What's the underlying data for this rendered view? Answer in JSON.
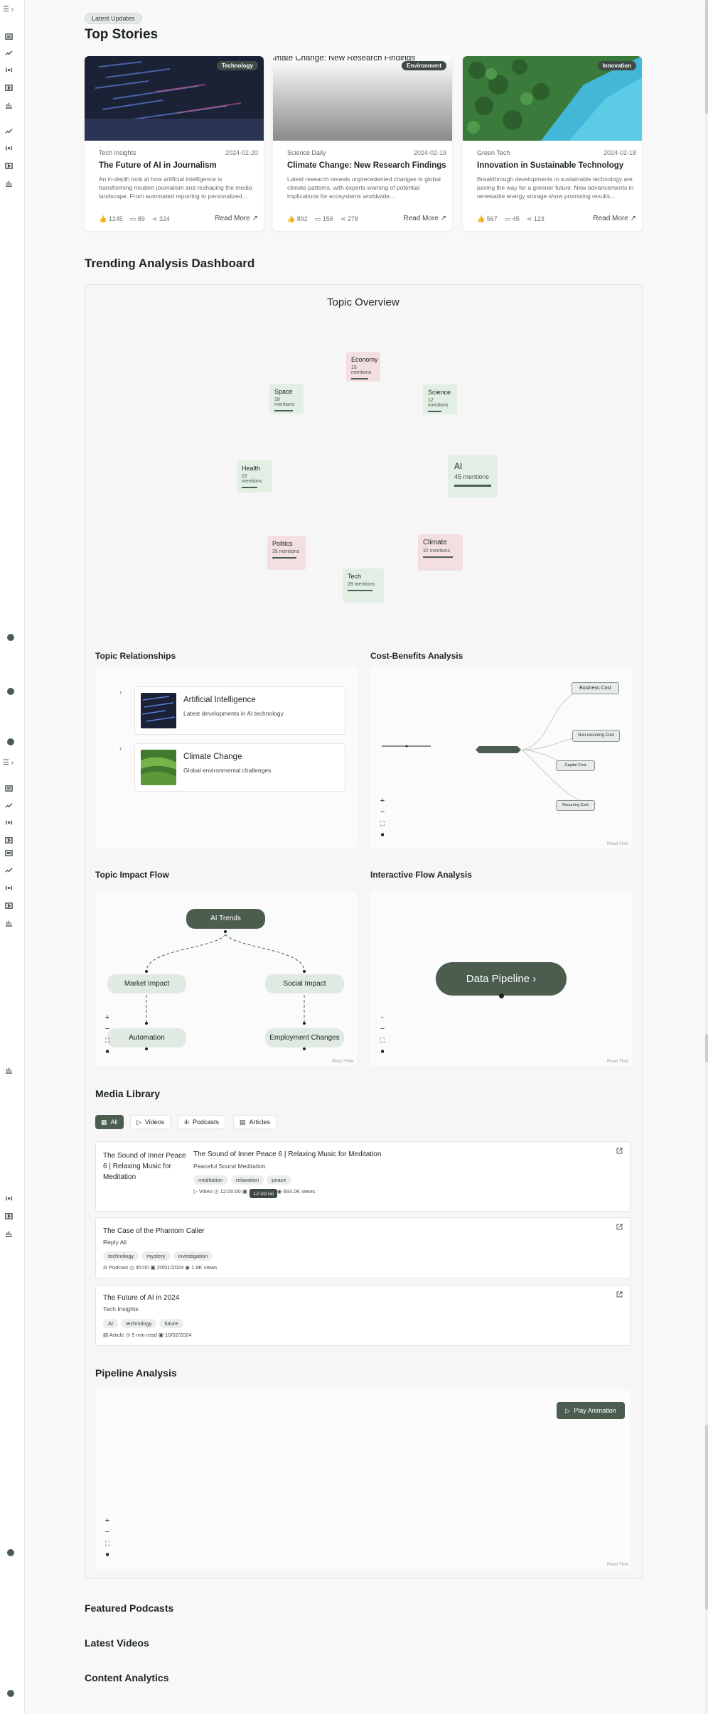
{
  "sidebar": {
    "toggle_label": "☰ ›",
    "icons": [
      "newspaper-icon",
      "trending-icon",
      "broadcast-icon",
      "video-icon",
      "chart-icon",
      "trending-icon",
      "broadcast-icon",
      "video-icon",
      "chart-icon"
    ]
  },
  "top_stories": {
    "badge": "Latest Updates",
    "title": "Top Stories",
    "cards": [
      {
        "tag": "Technology",
        "source": "Tech Insights",
        "date": "2024-02-20",
        "title": "The Future of AI in Journalism",
        "description": "An in-depth look at how artificial intelligence is transforming modern journalism and reshaping the media landscape. From automated reporting to personalized...",
        "likes": "1245",
        "comments": "89",
        "shares": "324",
        "read_more": "Read More"
      },
      {
        "tag": "Environment",
        "source": "Science Daily",
        "date": "2024-02-19",
        "title": "Climate Change: New Research Findings",
        "image_title": "imate Change: New Research Findings",
        "description": "Latest research reveals unprecedented changes in global climate patterns, with experts warning of potential implications for ecosystems worldwide...",
        "likes": "892",
        "comments": "156",
        "shares": "278",
        "read_more": "Read More"
      },
      {
        "tag": "Innovation",
        "source": "Green Tech",
        "date": "2024-02-18",
        "title": "Innovation in Sustainable Technology",
        "description": "Breakthrough developments in sustainable technology are paving the way for a greener future. New advancements in renewable energy storage show promising results...",
        "likes": "567",
        "comments": "45",
        "shares": "123",
        "read_more": "Read More"
      }
    ]
  },
  "dashboard": {
    "title": "Trending Analysis Dashboard",
    "overview_title": "Topic Overview",
    "topics": [
      {
        "name": "Economy",
        "count": "15 mentions",
        "tone": "red"
      },
      {
        "name": "Space",
        "count": "18 mentions",
        "tone": "green"
      },
      {
        "name": "Science",
        "count": "12 mentions",
        "tone": "green"
      },
      {
        "name": "Health",
        "count": "22 mentions",
        "tone": "green"
      },
      {
        "name": "AI",
        "count": "45 mentions",
        "tone": "green"
      },
      {
        "name": "Politics",
        "count": "35 mentions",
        "tone": "red"
      },
      {
        "name": "Climate",
        "count": "32 mentions",
        "tone": "red"
      },
      {
        "name": "Tech",
        "count": "28 mentions",
        "tone": "green"
      }
    ],
    "relationships": {
      "title": "Topic Relationships",
      "items": [
        {
          "title": "Artificial Intelligence",
          "subtitle": "Latest developments in AI technology"
        },
        {
          "title": "Climate Change",
          "subtitle": "Global environmental challenges"
        }
      ]
    },
    "cost_benefits": {
      "title": "Cost-Benefits Analysis",
      "nodes": [
        "Business Cost",
        "Non-recurring Cost",
        "Capital Cost",
        "Recurring Cost"
      ],
      "attribution": "React Flow"
    },
    "impact_flow": {
      "title": "Topic Impact Flow",
      "root": "AI Trends",
      "nodes": [
        "Market Impact",
        "Social Impact",
        "Automation",
        "Employment Changes"
      ],
      "attribution": "React Flow"
    },
    "interactive_flow": {
      "title": "Interactive Flow Analysis",
      "node": "Data Pipeline",
      "attribution": "React Flow"
    },
    "media_library": {
      "title": "Media Library",
      "tabs": [
        "All",
        "Videos",
        "Podcasts",
        "Articles"
      ],
      "items": [
        {
          "thumb_title": "The Sound of Inner Peace 6 | Relaxing Music for Meditation",
          "duration_badge": "12:00:00",
          "title": "The Sound of Inner Peace 6 | Relaxing Music for Meditation",
          "subtitle": "Peaceful Sound Meditation",
          "tags": [
            "meditation",
            "relaxation",
            "peace"
          ],
          "type": "Video",
          "duration": "12:00:00",
          "date": "15/09/2023",
          "views": "693.0K views"
        },
        {
          "title": "The Case of the Phantom Caller",
          "subtitle": "Reply All",
          "tags": [
            "technology",
            "mystery",
            "investigation"
          ],
          "type": "Podcast",
          "duration": "45:00",
          "date": "20/01/2024",
          "views": "1.9K views"
        },
        {
          "title": "The Future of AI in 2024",
          "subtitle": "Tech Insights",
          "tags": [
            "AI",
            "technology",
            "future"
          ],
          "type": "Article",
          "duration": "5 min read",
          "date": "10/02/2024"
        }
      ]
    },
    "pipeline": {
      "title": "Pipeline Analysis",
      "play_label": "Play Animation",
      "attribution": "React Flow"
    }
  },
  "bottom_sections": [
    "Featured Podcasts",
    "Latest Videos",
    "Content Analytics"
  ],
  "colors": {
    "accent": "#4a5d4f",
    "topic_green": "#e1efe4",
    "topic_red": "#f4dfe0",
    "background": "#f7f8f7"
  }
}
